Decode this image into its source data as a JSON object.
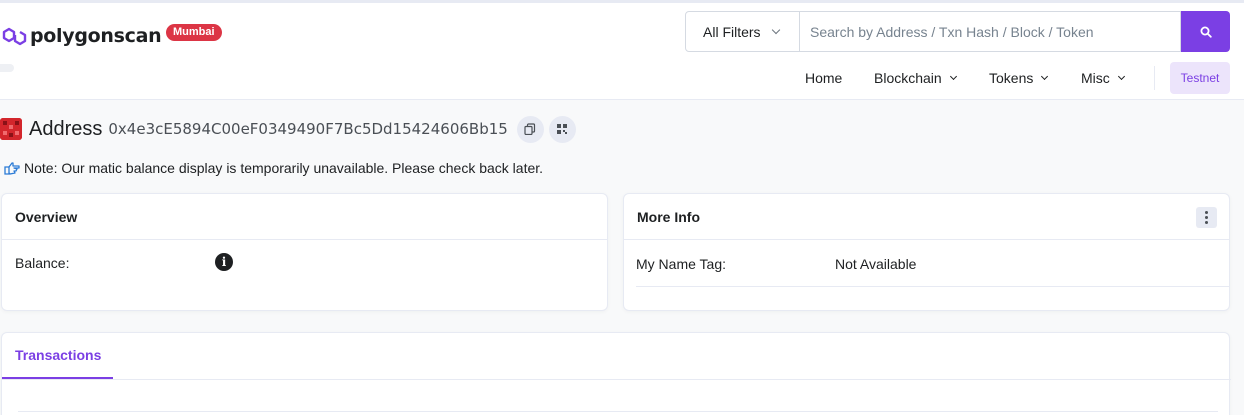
{
  "brand": {
    "name": "polygonscan",
    "network_badge": "Mumbai",
    "accent_color": "#7b3fe4"
  },
  "search": {
    "filter_label": "All Filters",
    "placeholder": "Search by Address / Txn Hash / Block / Token",
    "button_icon": "search-icon"
  },
  "nav": {
    "home": "Home",
    "blockchain": "Blockchain",
    "tokens": "Tokens",
    "misc": "Misc",
    "testnet": "Testnet"
  },
  "page": {
    "title": "Address",
    "address": "0x4e3cE5894C00eF0349490F7Bc5Dd15424606Bb15",
    "note": "Note: Our matic balance display is temporarily unavailable. Please check back later."
  },
  "overview": {
    "title": "Overview",
    "balance_label": "Balance:"
  },
  "more_info": {
    "title": "More Info",
    "name_tag_label": "My Name Tag:",
    "name_tag_value": "Not Available"
  },
  "transactions": {
    "tab_label": "Transactions"
  }
}
